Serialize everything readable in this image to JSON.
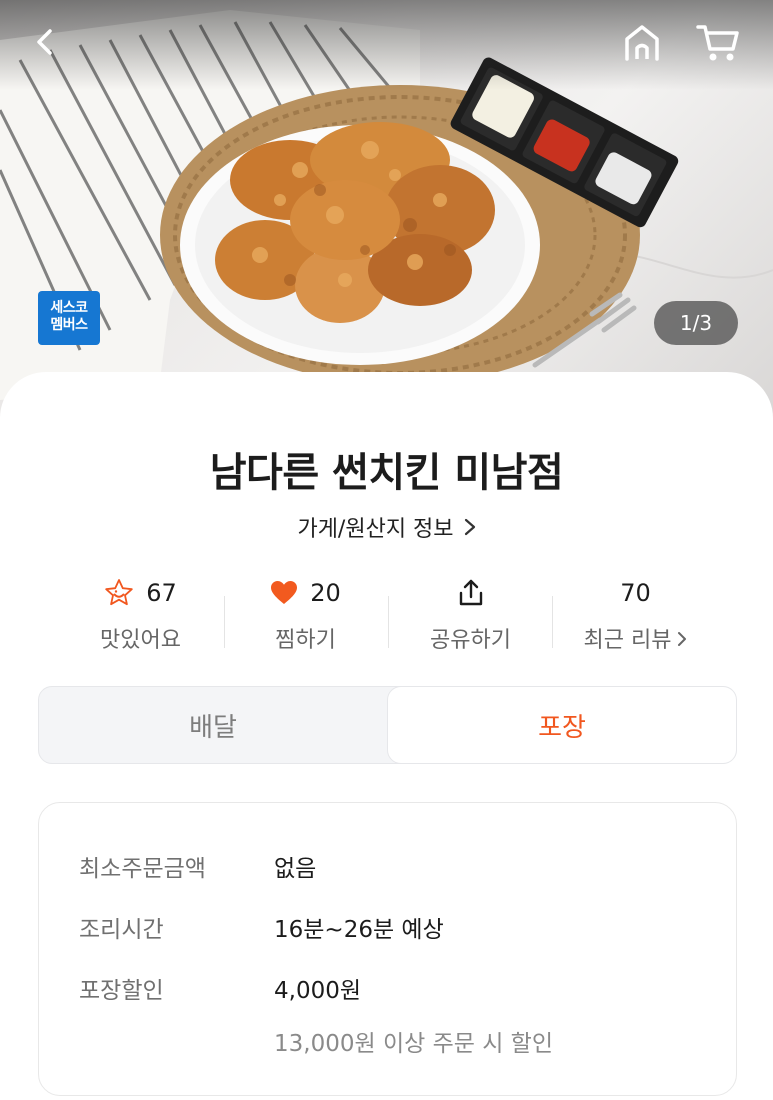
{
  "header": {
    "back_icon": "chevron-left-icon",
    "home_icon": "home-icon",
    "cart_icon": "cart-icon",
    "badge_line1": "세스코",
    "badge_line2": "멤버스",
    "image_counter": "1/3"
  },
  "store": {
    "name": "남다른 썬치킨 미남점",
    "info_link": "가게/원산지 정보"
  },
  "stats": [
    {
      "icon": "star-face-icon",
      "count": "67",
      "label": "맛있어요"
    },
    {
      "icon": "heart-icon",
      "count": "20",
      "label": "찜하기"
    },
    {
      "icon": "share-icon",
      "count": "",
      "label": "공유하기"
    },
    {
      "icon": "",
      "count": "70",
      "label": "최근 리뷰"
    }
  ],
  "tabs": {
    "delivery": "배달",
    "takeout": "포장",
    "selected": "takeout"
  },
  "info": {
    "min_order_label": "최소주문금액",
    "min_order_value": "없음",
    "cook_time_label": "조리시간",
    "cook_time_value": "16분~26분 예상",
    "discount_label": "포장할인",
    "discount_value": "4,000원",
    "discount_condition": "13,000원 이상 주문 시 할인"
  },
  "colors": {
    "accent": "#f1571f",
    "badge_blue": "#1677d2",
    "heart": "#f25a1f"
  }
}
